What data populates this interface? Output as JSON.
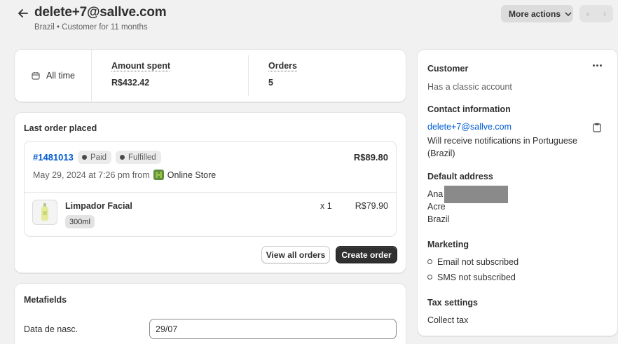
{
  "header": {
    "title": "delete+7@sallve.com",
    "subtitle": "Brazil • Customer for 11 months",
    "more_actions_label": "More actions"
  },
  "stats": {
    "time_filter": "All time",
    "amount_spent_label": "Amount spent",
    "amount_spent_value": "R$432.42",
    "orders_label": "Orders",
    "orders_value": "5"
  },
  "last_order": {
    "title": "Last order placed",
    "order_number": "#1481013",
    "payment_badge": "Paid",
    "fulfillment_badge": "Fulfilled",
    "total": "R$89.80",
    "date_text": "May 29, 2024 at 7:26 pm from",
    "channel": "Online Store",
    "item": {
      "name": "Limpador Facial",
      "variant": "300ml",
      "quantity": "x 1",
      "price": "R$79.90"
    },
    "view_all_label": "View all orders",
    "create_order_label": "Create order"
  },
  "metafields": {
    "title": "Metafields",
    "field_label": "Data de nasc.",
    "field_value": "29/07"
  },
  "customer": {
    "title": "Customer",
    "account_type": "Has a classic account",
    "contact_title": "Contact information",
    "email": "delete+7@sallve.com",
    "notification_line1": "Will receive notifications in Portuguese",
    "notification_line2": "(Brazil)",
    "address_title": "Default address",
    "address_name": "Ana",
    "address_state": "Acre",
    "address_country": "Brazil",
    "marketing_title": "Marketing",
    "email_marketing": "Email not subscribed",
    "sms_marketing": "SMS not subscribed",
    "tax_title": "Tax settings",
    "tax_value": "Collect tax"
  },
  "icons": [
    "arrow-left-icon",
    "chevron-down-icon",
    "chevron-left-icon",
    "chevron-right-icon",
    "calendar-icon",
    "store-icon",
    "product-thumbnail",
    "more-horizontal-icon",
    "clipboard-icon"
  ],
  "colors": {
    "link": "#005bd3",
    "primary_button": "#303030",
    "background": "#f1f1f1"
  }
}
